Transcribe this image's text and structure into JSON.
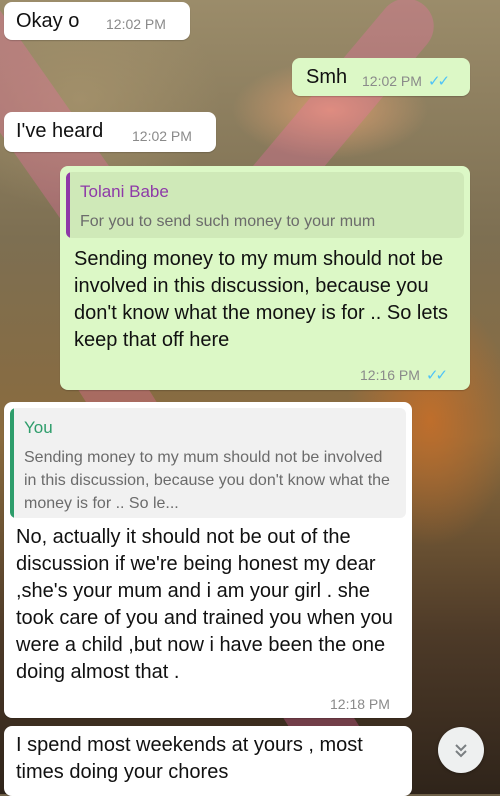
{
  "messages": [
    {
      "text": "Okay o",
      "time": "12:02 PM"
    },
    {
      "text": "Smh",
      "time": "12:02 PM"
    },
    {
      "text": "I've heard",
      "time": "12:02 PM"
    },
    {
      "quote_name": "Tolani Babe",
      "quote_text": "For you to send such money to your mum",
      "text": "Sending money to my mum should not be involved in this discussion, because you don't know what the money is for .. So lets keep that off here",
      "time": "12:16 PM"
    },
    {
      "quote_name": "You",
      "quote_text": "Sending money to my mum should not be involved in this discussion, because you don't know what the money is for .. So le...",
      "text": "No, actually it should not be out of the discussion if we're being honest my dear ,she's your mum and i am your girl . she took care of you and trained you when you were a child ,but now i have been the one doing almost that .",
      "time": "12:18 PM"
    },
    {
      "text": "I spend most weekends at yours , most times doing your chores"
    }
  ],
  "icons": {
    "read_receipt": "double-check-icon",
    "scroll_down": "chevron-double-down-icon"
  },
  "colors": {
    "incoming": "#ffffff",
    "outgoing": "#dcf8c6",
    "read_ticks": "#4fc3f7",
    "quote_accent_in": "#8e3aa8",
    "quote_accent_out": "#2e9d6b"
  }
}
